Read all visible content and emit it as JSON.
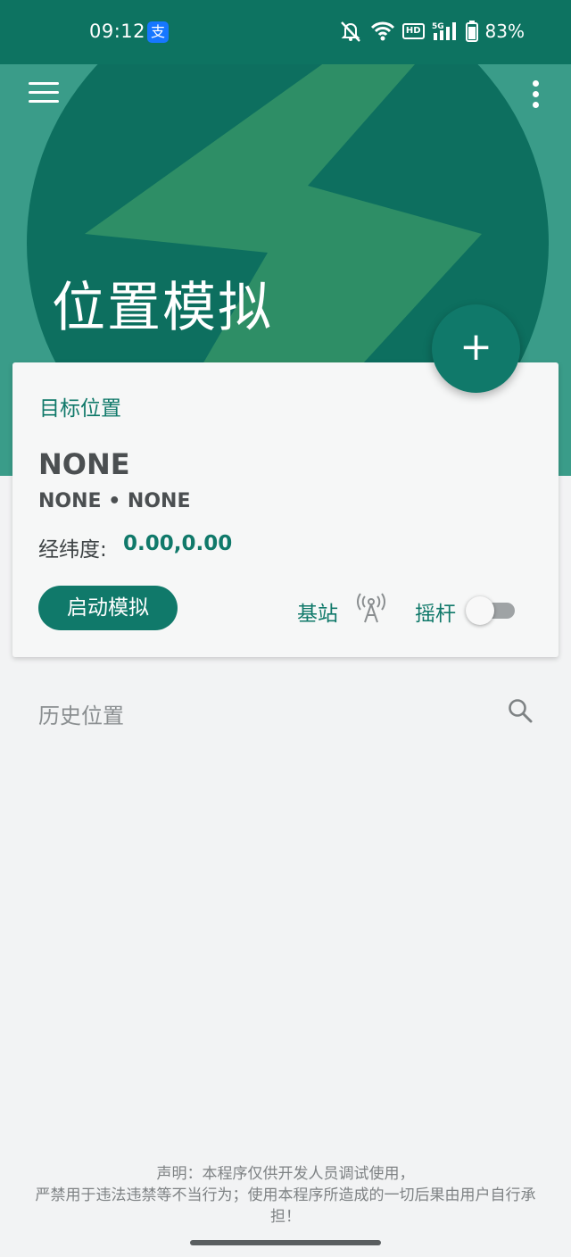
{
  "status_bar": {
    "time": "09:12",
    "app_icon_glyph": "支",
    "battery": "83%",
    "network": "5G",
    "hd": "HD",
    "icons": [
      "mute-icon",
      "wifi-icon",
      "hd-icon",
      "signal-5g-icon",
      "battery-icon"
    ]
  },
  "header": {
    "title": "位置模拟",
    "background_color": "#3a9c89",
    "circle_color": "#0d6f5f",
    "bolt_color": "#2e8e66"
  },
  "toolbar": {
    "menu_icon": "menu-icon",
    "more_icon": "more-vert-icon"
  },
  "fab": {
    "label": "+"
  },
  "target": {
    "heading": "目标位置",
    "name": "NONE",
    "subtitle": "NONE • NONE",
    "coords_label": "经纬度:",
    "coords_value": "0.00,0.00"
  },
  "controls": {
    "start_label": "启动模拟",
    "base_station_label": "基站",
    "joystick_label": "摇杆",
    "joystick_on": false
  },
  "history": {
    "title": "历史位置"
  },
  "disclaimer": {
    "line1": "声明：本程序仅供开发人员调试使用，",
    "line2": "严禁用于违法违禁等不当行为；使用本程序所造成的一切后果由用户自行承",
    "line3": "担！"
  },
  "colors": {
    "accent": "#10796a",
    "status_bar": "#0d7361"
  }
}
